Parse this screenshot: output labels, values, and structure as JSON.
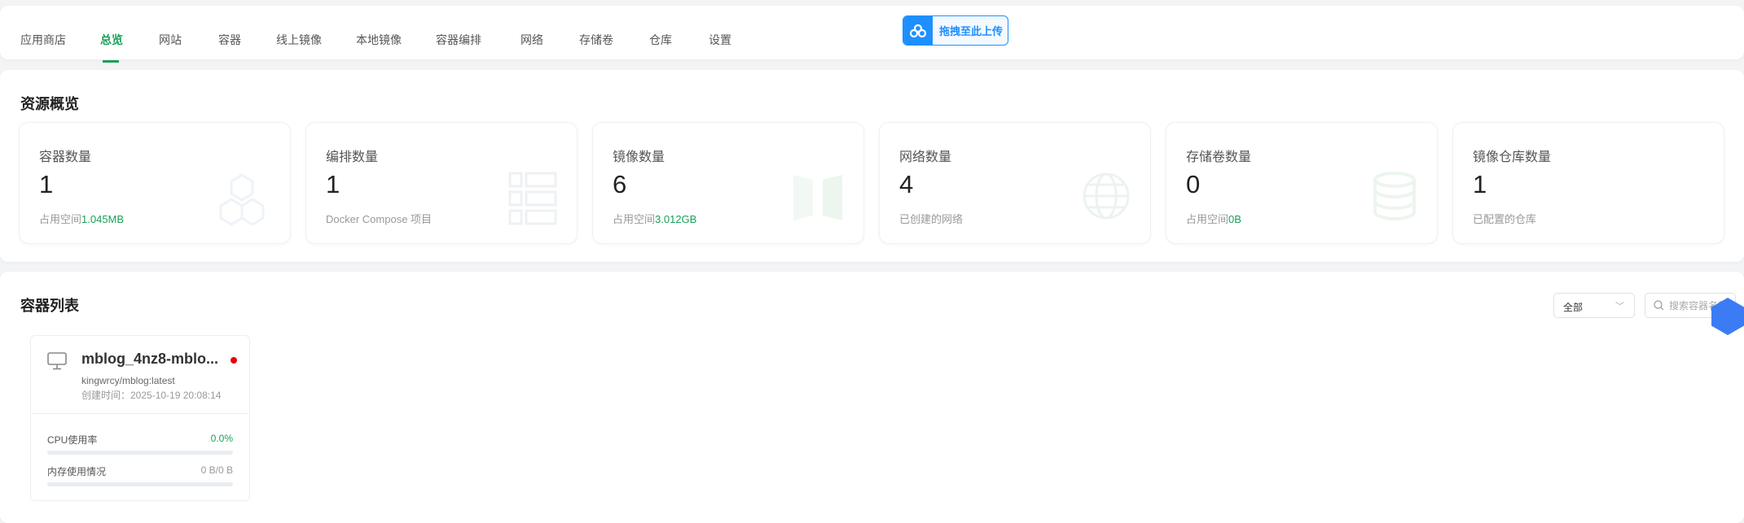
{
  "nav": {
    "items": [
      "应用商店",
      "总览",
      "网站",
      "容器",
      "线上镜像",
      "本地镜像",
      "容器编排",
      "网络",
      "存储卷",
      "仓库",
      "设置"
    ],
    "active_index": 1,
    "upload_label": "拖拽至此上传"
  },
  "overview": {
    "title": "资源概览",
    "cards": [
      {
        "label": "容器数量",
        "value": "1",
        "sub_prefix": "占用空间",
        "sub_value": "1.045MB",
        "icon": "cubes-icon"
      },
      {
        "label": "编排数量",
        "value": "1",
        "sub_prefix": "Docker Compose 项目",
        "sub_value": "",
        "icon": "list-grid-icon"
      },
      {
        "label": "镜像数量",
        "value": "6",
        "sub_prefix": "占用空间",
        "sub_value": "3.012GB",
        "icon": "image-panels-icon"
      },
      {
        "label": "网络数量",
        "value": "4",
        "sub_prefix": "已创建的网络",
        "sub_value": "",
        "icon": "globe-icon"
      },
      {
        "label": "存储卷数量",
        "value": "0",
        "sub_prefix": "占用空间",
        "sub_value": "0B",
        "icon": "database-icon"
      },
      {
        "label": "镜像仓库数量",
        "value": "1",
        "sub_prefix": "已配置的仓库",
        "sub_value": "",
        "icon": "warehouse-icon"
      }
    ]
  },
  "containers": {
    "title": "容器列表",
    "filter_value": "全部",
    "search_placeholder": "搜索容器名称",
    "items": [
      {
        "name": "mblog_4nz8-mblo...",
        "image": "kingwrcy/mblog:latest",
        "created": "创建时间：2025-10-19 20:08:14",
        "status_color": "#e60012",
        "cpu_label": "CPU使用率",
        "cpu_value": "0.0%",
        "cpu_percent": 0,
        "mem_label": "内存使用情况",
        "mem_value": "0 B/0 B",
        "mem_percent": 0
      }
    ]
  },
  "colors": {
    "accent": "#18a058",
    "upload": "#1e8fff"
  }
}
